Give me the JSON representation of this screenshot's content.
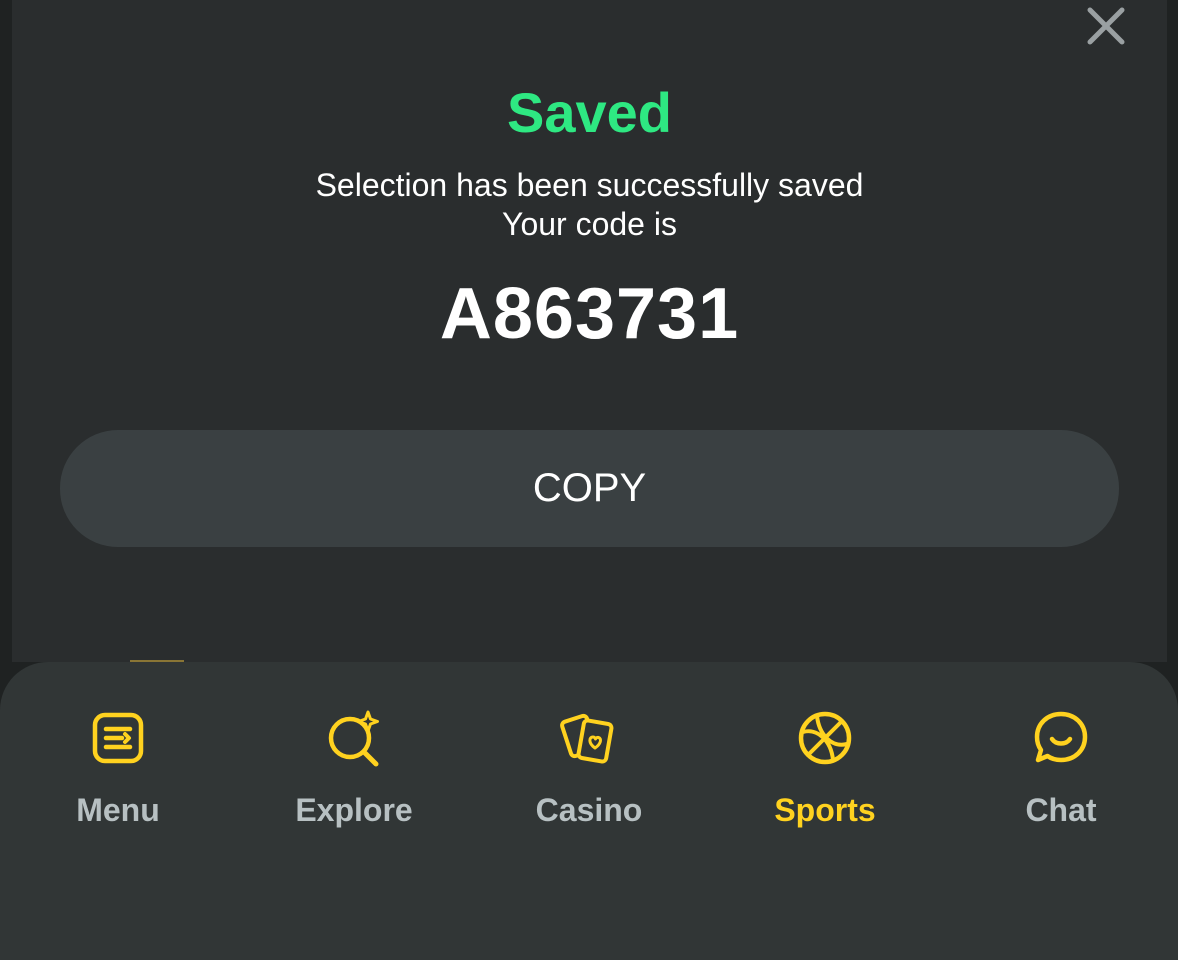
{
  "modal": {
    "title": "Saved",
    "message_line1": "Selection has been successfully saved",
    "message_line2": "Your code is",
    "code": "A863731",
    "copy_label": "COPY",
    "close_icon": "close-icon"
  },
  "nav": {
    "active": "Sports",
    "items": [
      {
        "label": "Menu",
        "icon": "menu-icon"
      },
      {
        "label": "Explore",
        "icon": "explore-icon"
      },
      {
        "label": "Casino",
        "icon": "casino-icon"
      },
      {
        "label": "Sports",
        "icon": "basketball-icon"
      },
      {
        "label": "Chat",
        "icon": "chat-icon"
      }
    ]
  },
  "colors": {
    "success": "#2ee882",
    "accent": "#ffd21f",
    "modal_bg": "#2a2d2e",
    "nav_bg": "#313636",
    "button_bg": "#3a4042",
    "nav_label": "#b7c0c2"
  }
}
